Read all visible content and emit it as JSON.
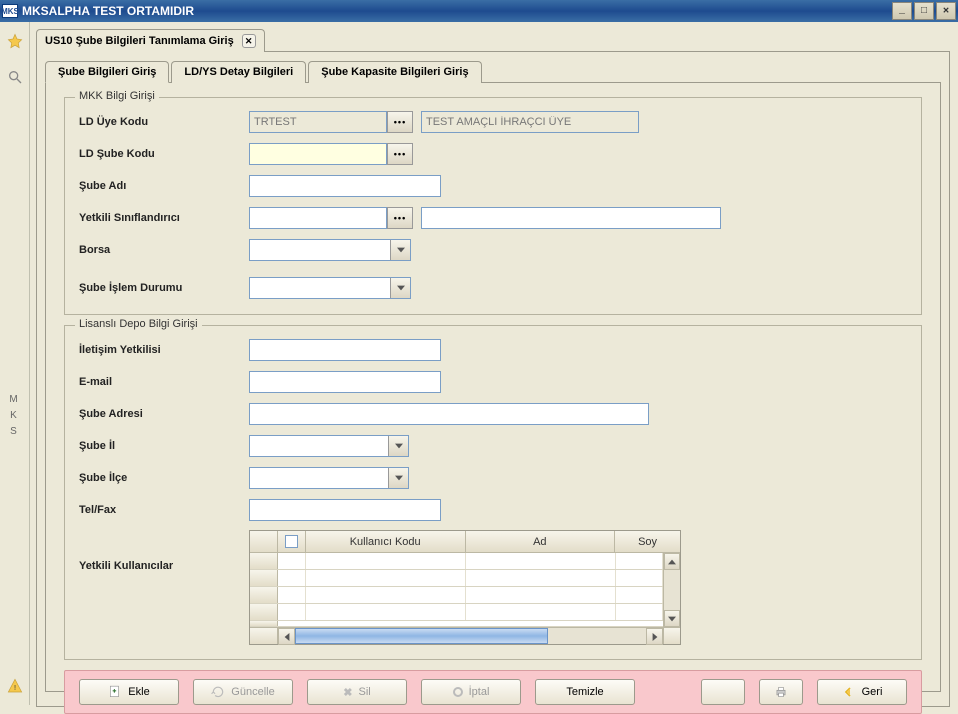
{
  "window": {
    "appBadge": "MKS",
    "title": "MKSALPHA TEST ORTAMIDIR"
  },
  "docTab": {
    "label": "US10 Şube Bilgileri Tanımlama Giriş"
  },
  "tabs": {
    "t1": "Şube Bilgileri Giriş",
    "t2": "LD/YS Detay Bilgileri",
    "t3": "Şube Kapasite Bilgileri Giriş"
  },
  "group1": {
    "legend": "MKK Bilgi Girişi",
    "ldUyeKodu": {
      "label": "LD Üye Kodu",
      "value": "TRTEST",
      "desc": "TEST AMAÇLI İHRAÇCI ÜYE"
    },
    "ldSubeKodu": {
      "label": "LD Şube Kodu",
      "value": ""
    },
    "subeAdi": {
      "label": "Şube Adı",
      "value": ""
    },
    "yetkili": {
      "label": "Yetkili Sınıflandırıcı",
      "value": "",
      "desc": ""
    },
    "borsa": {
      "label": "Borsa",
      "value": ""
    },
    "durum": {
      "label": "Şube İşlem Durumu",
      "value": ""
    }
  },
  "group2": {
    "legend": "Lisanslı Depo Bilgi Girişi",
    "iletisim": {
      "label": "İletişim Yetkilisi",
      "value": ""
    },
    "email": {
      "label": "E-mail",
      "value": ""
    },
    "adres": {
      "label": "Şube Adresi",
      "value": ""
    },
    "il": {
      "label": "Şube İl",
      "value": ""
    },
    "ilce": {
      "label": "Şube İlçe",
      "value": ""
    },
    "telfax": {
      "label": "Tel/Fax",
      "value": ""
    },
    "kullanicilar": {
      "label": "Yetkili Kullanıcılar"
    }
  },
  "grid": {
    "cols": {
      "c1": "Kullanıcı Kodu",
      "c2": "Ad",
      "c3": "Soy"
    }
  },
  "toolbar": {
    "ekle": "Ekle",
    "guncelle": "Güncelle",
    "sil": "Sil",
    "iptal": "İptal",
    "temizle": "Temizle",
    "geri": "Geri"
  },
  "side": {
    "letters": "M\nK\nS"
  }
}
